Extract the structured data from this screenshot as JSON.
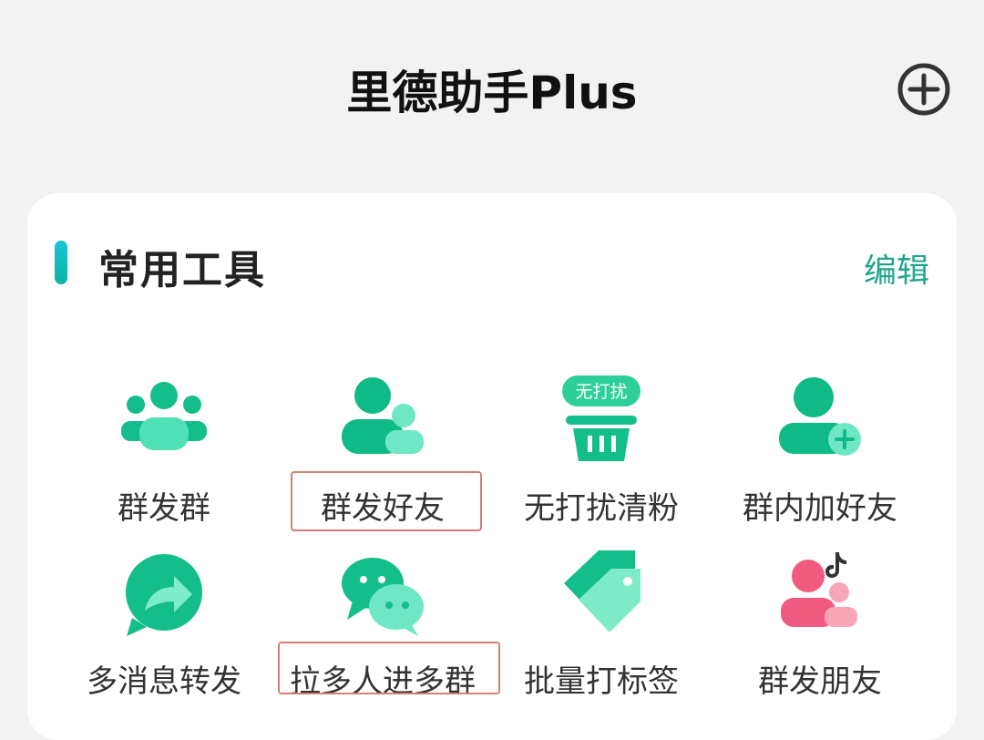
{
  "header": {
    "title": "里德助手Plus",
    "add_icon": "plus-circle-icon"
  },
  "section": {
    "title": "常用工具",
    "edit_label": "编辑",
    "accent_color": "#12bfbf"
  },
  "tools": [
    {
      "label": "群发群",
      "icon": "group-icon"
    },
    {
      "label": "群发好友",
      "icon": "friends-icon",
      "highlighted": true
    },
    {
      "label": "无打扰清粉",
      "icon": "basket-icon",
      "badge": "无打扰"
    },
    {
      "label": "群内加好友",
      "icon": "add-user-icon"
    },
    {
      "label": "多消息转发",
      "icon": "forward-icon"
    },
    {
      "label": "拉多人进多群",
      "icon": "chat-icon",
      "highlighted": true
    },
    {
      "label": "批量打标签",
      "icon": "tag-icon"
    },
    {
      "label": "群发朋友",
      "icon": "douyin-friends-icon"
    }
  ],
  "colors": {
    "primary": "#0bbf8a",
    "secondary": "#7ee7c6",
    "edit": "#21a58b",
    "highlight_border": "#d37f79",
    "pink": "#f05a7e"
  }
}
